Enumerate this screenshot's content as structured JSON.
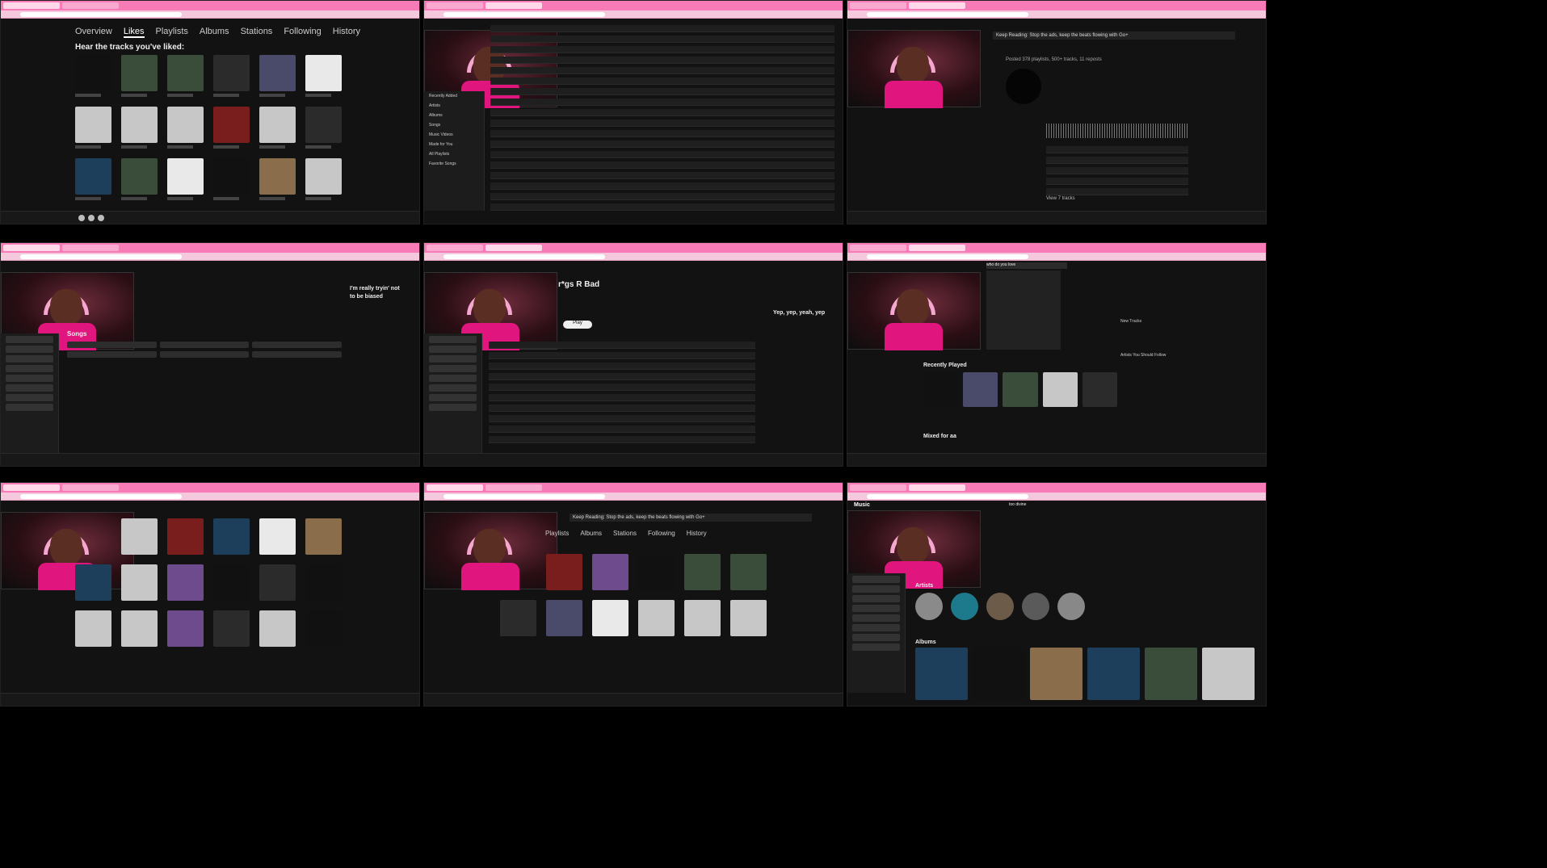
{
  "panels": [
    {
      "id": "p1",
      "nav_tabs": [
        "Overview",
        "Likes",
        "Playlists",
        "Albums",
        "Stations",
        "Following",
        "History"
      ],
      "active_tab": "Likes",
      "heading": "Hear the tracks you've liked:",
      "tiles": 18
    },
    {
      "id": "p2",
      "sidebar": [
        "Recently Added",
        "Artists",
        "Albums",
        "Songs",
        "Music Videos",
        "Made for You",
        "All Playlists",
        "Favorite Songs"
      ],
      "tracks": 18
    },
    {
      "id": "p3",
      "banner": "Keep Reading: Stop the ads, keep the beats flowing with Go+",
      "stats": "Posted 378 playlists, 500+ tracks, 11 reposts",
      "tracks": 5,
      "link": "View 7 tracks"
    },
    {
      "id": "p4",
      "lyrics": [
        "I'm really tryin' not",
        "to be biased"
      ],
      "section": "Songs"
    },
    {
      "id": "p5",
      "title": "r*gs R Bad",
      "play_label": "Play",
      "lyrics": [
        "Yep, yep, yeah, yep"
      ]
    },
    {
      "id": "p6",
      "search_query": "who do you love",
      "recent": "Recently Played",
      "mixed": "Mixed for aa",
      "side_sections": [
        "New Tracks",
        "Artists You Should Follow"
      ]
    },
    {
      "id": "p7",
      "tiles": 18
    },
    {
      "id": "p8",
      "banner": "Keep Reading: Stop the ads, keep the beats flowing with Go+",
      "nav_tabs": [
        "Playlists",
        "Albums",
        "Stations",
        "Following",
        "History"
      ],
      "tiles": 18
    },
    {
      "id": "p9",
      "brand": "Music",
      "search_query": "too divine",
      "sections": [
        "Artists",
        "Albums"
      ]
    }
  ]
}
